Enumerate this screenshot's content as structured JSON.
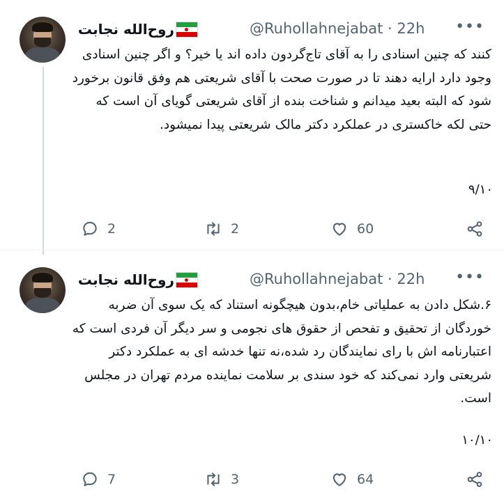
{
  "tweets": [
    {
      "author_name": "روح‌الله نجابت",
      "handle": "@Ruhollahnejabat",
      "time": "22h",
      "more": "•••",
      "text": "کنند که چنین اسنادی را به آقای تاج‌گردون داده اند یا خیر؟ و اگر چنین اسنادی وجود دارد ارایه دهند تا در صورت صحت با آقای شریعتی هم وفق قانون برخورد شود که البته بعید میدانم و شناخت بنده از آقای شریعتی گویای آن است که حتی لکه خاکستری در عملکرد دکتر مالک شریعتی پیدا نمیشود.",
      "counter": "۹/۱۰",
      "replies": "2",
      "retweets": "2",
      "likes": "60"
    },
    {
      "author_name": "روح‌الله نجابت",
      "handle": "@Ruhollahnejabat",
      "time": "22h",
      "more": "•••",
      "text": "۶.شکل دادن به عملیاتی خام،بدون هیچگونه استناد که یک سوی آن ضربه خوردگان از تحقیق و تفحص از حقوق های نجومی و سر دیگر آن فردی است که اعتبارنامه اش با رای نمایندگان رد شده،نه تنها خدشه ای به عملکرد دکتر شریعتی وارد نمی‌کند که خود سندی بر سلامت نماینده مردم تهران در مجلس است.",
      "counter": "۱۰/۱۰",
      "replies": "7",
      "retweets": "3",
      "likes": "64"
    }
  ],
  "icons": {
    "reply": "reply-icon",
    "retweet": "retweet-icon",
    "like": "heart-icon",
    "share": "share-icon"
  },
  "colors": {
    "text": "#0f1419",
    "muted": "#536471",
    "thread_line": "#cfd9de"
  }
}
